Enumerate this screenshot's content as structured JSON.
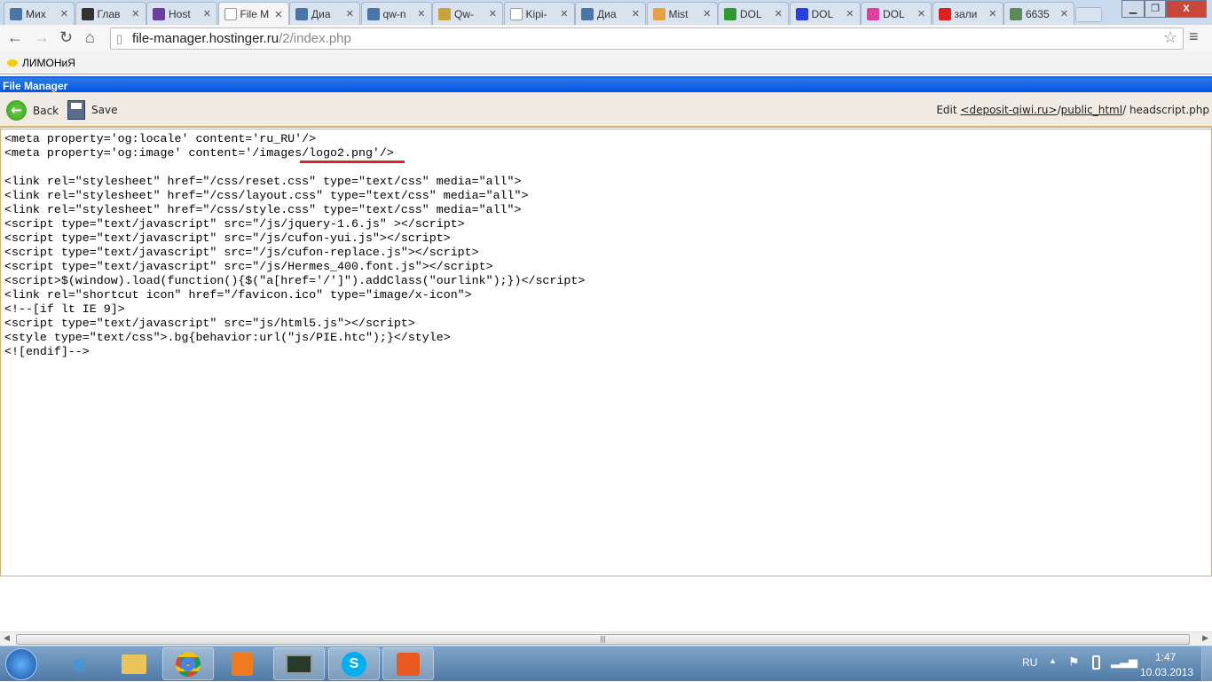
{
  "browser": {
    "tabs": [
      {
        "title": "Мих",
        "icon": "vk-icon",
        "color": "#4a76a8"
      },
      {
        "title": "Глав",
        "icon": "mi-icon",
        "color": "#333333"
      },
      {
        "title": "Host",
        "icon": "hostinger-icon",
        "color": "#6b3fa0"
      },
      {
        "title": "File M",
        "icon": "page-icon",
        "color": "#ffffff",
        "active": true
      },
      {
        "title": "Диа",
        "icon": "chat-icon",
        "color": "#4a76a8"
      },
      {
        "title": "qw-n",
        "icon": "vk-icon",
        "color": "#4a76a8"
      },
      {
        "title": "Qw-",
        "icon": "coins-icon",
        "color": "#c9a23a"
      },
      {
        "title": "Kipi-",
        "icon": "page-icon",
        "color": "#ffffff"
      },
      {
        "title": "Диа",
        "icon": "chat-icon",
        "color": "#4a76a8"
      },
      {
        "title": "Mist",
        "icon": "mp-icon",
        "color": "#e8a040"
      },
      {
        "title": "DOL",
        "icon": "dollar-icon",
        "color": "#2f9a2f"
      },
      {
        "title": "DOL",
        "icon": "dollar-icon",
        "color": "#2b3fe0"
      },
      {
        "title": "DOL",
        "icon": "dollar-icon",
        "color": "#e040a0"
      },
      {
        "title": "зали",
        "icon": "yandex-icon",
        "color": "#e02020"
      },
      {
        "title": "6635",
        "icon": "image-icon",
        "color": "#5a8a5a"
      }
    ],
    "url_host": "file-manager.hostinger.ru",
    "url_path": "/2/index.php",
    "bookmark": "ЛИМОНиЯ"
  },
  "fm": {
    "title": "File Manager",
    "back_label": "Back",
    "save_label": "Save",
    "edit_label": "Edit",
    "path_domain": "<deposit-qiwi.ru>",
    "path_sep1": "/",
    "path_folder": "public_html",
    "path_sep2": "/ ",
    "filename": "headscript.php",
    "code": "<meta property='og:locale' content='ru_RU'/>\n<meta property='og:image' content='/images/logo2.png'/>\n\n<link rel=\"stylesheet\" href=\"/css/reset.css\" type=\"text/css\" media=\"all\">\n<link rel=\"stylesheet\" href=\"/css/layout.css\" type=\"text/css\" media=\"all\">\n<link rel=\"stylesheet\" href=\"/css/style.css\" type=\"text/css\" media=\"all\">\n<script type=\"text/javascript\" src=\"/js/jquery-1.6.js\" ></script>\n<script type=\"text/javascript\" src=\"/js/cufon-yui.js\"></script>\n<script type=\"text/javascript\" src=\"/js/cufon-replace.js\"></script>\n<script type=\"text/javascript\" src=\"/js/Hermes_400.font.js\"></script>\n<script>$(window).load(function(){$(\"a[href='/']\").addClass(\"ourlink\");})</script>\n<link rel=\"shortcut icon\" href=\"/favicon.ico\" type=\"image/x-icon\">\n<!--[if lt IE 9]>\n<script type=\"text/javascript\" src=\"js/html5.js\"></script>\n<style type=\"text/css\">.bg{behavior:url(\"js/PIE.htc\");}</style>\n<![endif]-->"
  },
  "taskbar": {
    "lang": "RU",
    "time": "1:47",
    "date": "10.03.2013"
  }
}
